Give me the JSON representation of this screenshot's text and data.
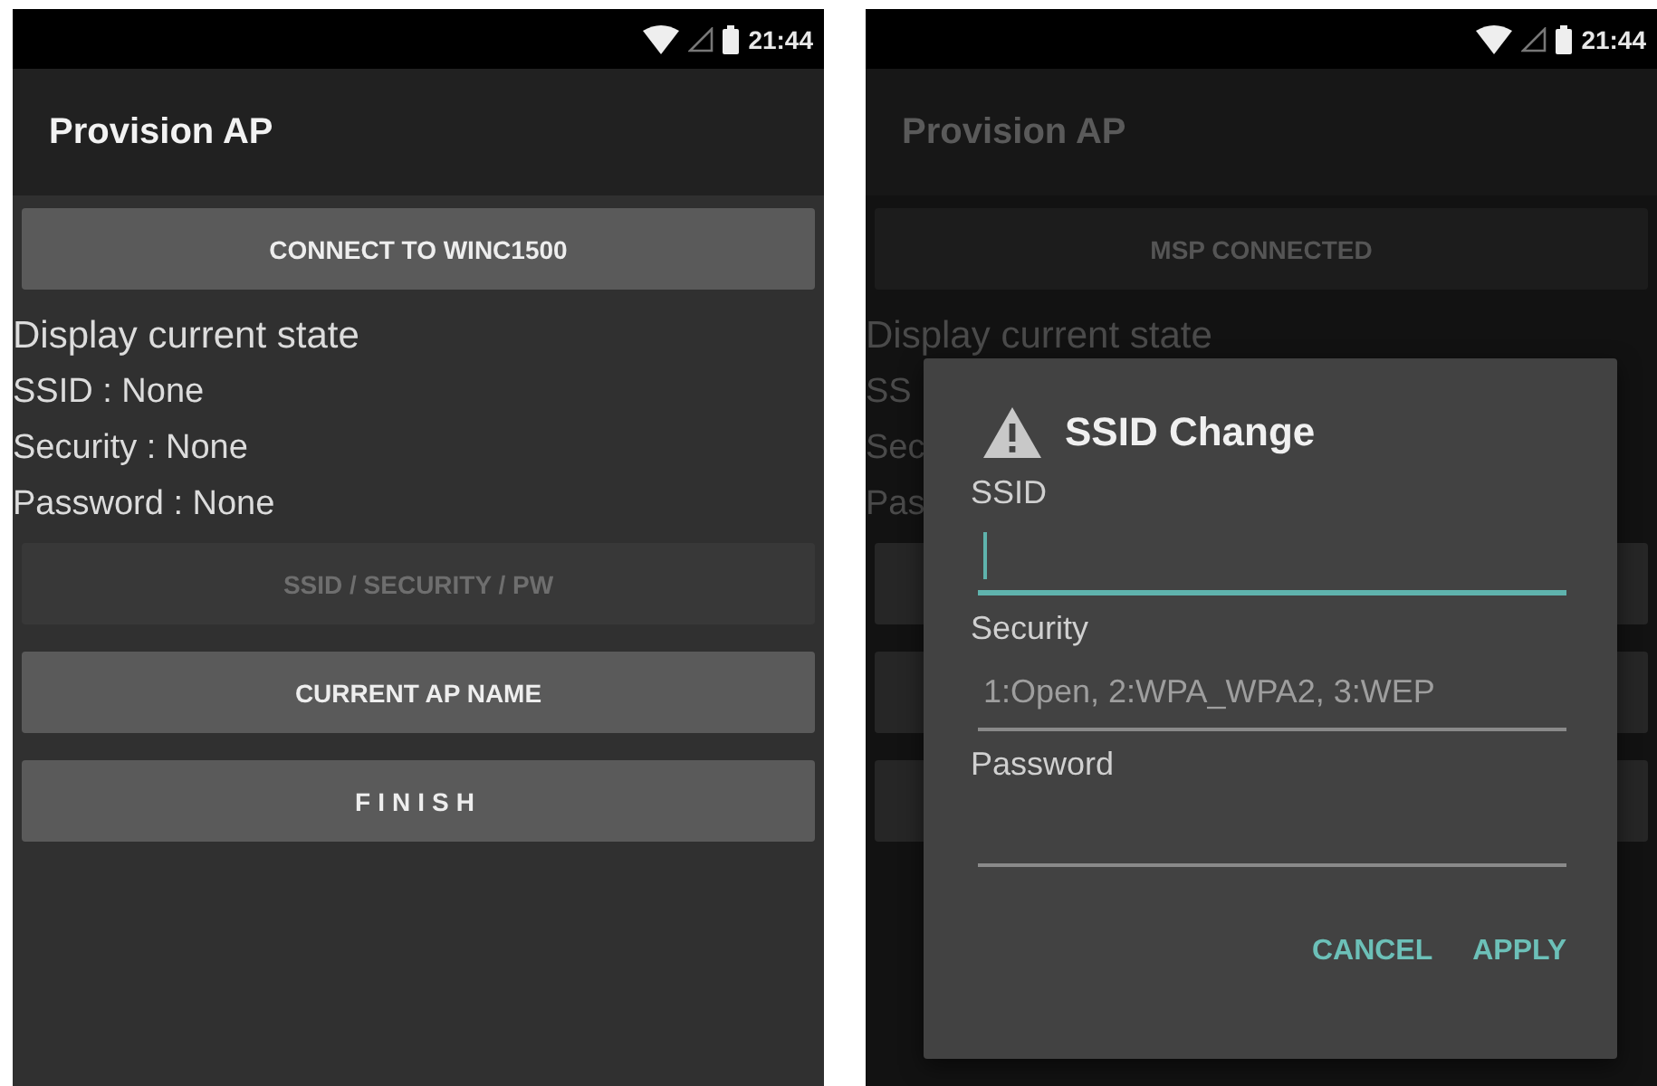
{
  "screens": [
    {
      "dimmed": false,
      "status_bar": {
        "time": "21:44"
      },
      "app_bar": {
        "title": "Provision AP"
      },
      "top_button": {
        "label": "CONNECT TO WINC1500",
        "disabled": false
      },
      "state_lines": [
        "Display current state",
        "SSID : None",
        "Security : None",
        "Password : None"
      ],
      "bottom_buttons": [
        {
          "label": "SSID / SECURITY / PW",
          "disabled": true,
          "spaced": false
        },
        {
          "label": "CURRENT AP NAME",
          "disabled": false,
          "spaced": false
        },
        {
          "label": "FINISH",
          "disabled": false,
          "spaced": true
        }
      ]
    },
    {
      "dimmed": true,
      "status_bar": {
        "time": "21:44"
      },
      "app_bar": {
        "title": "Provision AP"
      },
      "top_button": {
        "label": "MSP CONNECTED",
        "disabled": true
      },
      "state_lines": [
        "Display current state",
        "SS",
        "Sec",
        "Pas"
      ],
      "dialog": {
        "title": "SSID Change",
        "fields": [
          {
            "label": "SSID",
            "focused": true
          },
          {
            "label": "Security",
            "placeholder": "1:Open, 2:WPA_WPA2, 3:WEP",
            "focused": false
          },
          {
            "label": "Password",
            "focused": false
          }
        ],
        "actions": [
          "CANCEL",
          "APPLY"
        ]
      }
    }
  ]
}
